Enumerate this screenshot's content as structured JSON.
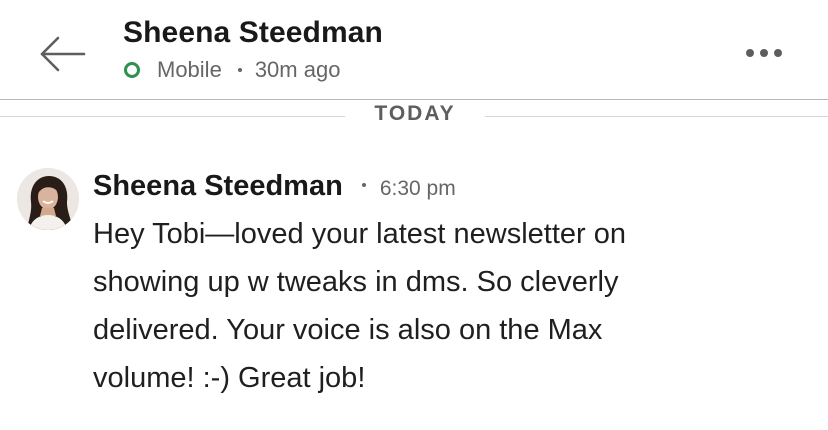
{
  "header": {
    "back_icon": "arrow-left-icon",
    "contact_name": "Sheena Steedman",
    "status": {
      "presence_icon": "online-ring-icon",
      "presence_color": "#2d9150",
      "device": "Mobile",
      "last_active": "30m ago"
    },
    "more_icon": "more-horizontal-icon"
  },
  "date_separator": {
    "label": "TODAY"
  },
  "messages": [
    {
      "sender": "Sheena Steedman",
      "avatar_icon": "profile-photo",
      "time": "6:30 pm",
      "body": "Hey Tobi—loved your latest newsletter on\nshowing up w tweaks in dms. So cleverly\ndelivered. Your voice is also on the Max\nvolume! :-) Great job!"
    }
  ],
  "colors": {
    "text_primary": "#191919",
    "text_secondary": "#666666",
    "online_green": "#2d9150",
    "divider": "#b8b8b8"
  }
}
